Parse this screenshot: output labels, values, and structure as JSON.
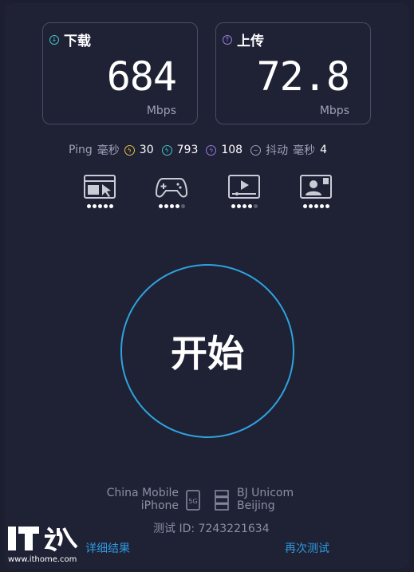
{
  "download": {
    "label": "下载",
    "value": "684",
    "unit": "Mbps",
    "color": "#3fc7c4"
  },
  "upload": {
    "label": "上传",
    "value": "72.8",
    "unit": "Mbps",
    "color": "#9b7be3"
  },
  "stats": {
    "ping_label": "Ping",
    "ms_label": "毫秒",
    "ping_values": [
      "30",
      "793",
      "108"
    ],
    "ping_colors": [
      "#e3c23f",
      "#3fc7c4",
      "#9b7be3"
    ],
    "jitter_label": "抖动",
    "jitter_ms_label": "毫秒",
    "jitter_value": "4"
  },
  "apps": [
    {
      "icon": "browser-icon",
      "level": 5
    },
    {
      "icon": "gamepad-icon",
      "level": 4
    },
    {
      "icon": "video-player-icon",
      "level": 4
    },
    {
      "icon": "video-call-icon",
      "level": 5
    }
  ],
  "start_label": "开始",
  "server": {
    "provider": "China Mobile",
    "device": "iPhone",
    "network_badge": "5G",
    "host": "BJ Unicom",
    "city": "Beijing",
    "test_id_label": "测试 ID:",
    "test_id": "7243221634"
  },
  "links": {
    "details": "详细结果",
    "retest": "再次测试"
  },
  "watermark": {
    "logo": "IT之家",
    "url": "www.ithome.com"
  },
  "accent": "#2ea3dd"
}
